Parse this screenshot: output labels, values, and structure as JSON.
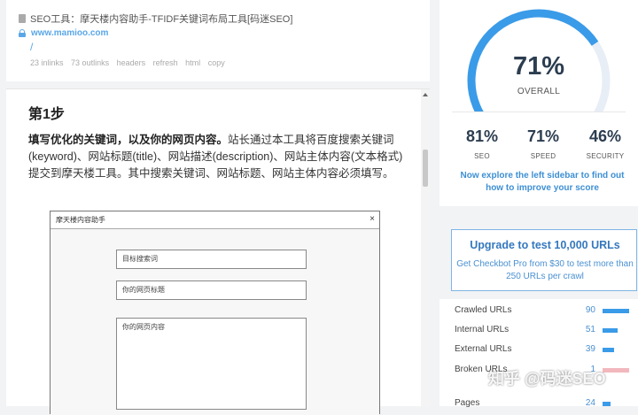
{
  "seo_card": {
    "title": "SEO工具：摩天楼内容助手-TFIDF关键词布局工具[码迷SEO]",
    "url": "www.mamioo.com",
    "path": "/",
    "links": [
      "23 inlinks",
      "73 outlinks",
      "headers",
      "refresh",
      "html",
      "copy"
    ]
  },
  "article": {
    "heading": "第1步",
    "bold_intro": "填写优化的关键词，以及你的网页内容。",
    "body": "站长通过本工具将百度搜索关键词(keyword)、网站标题(title)、网站描述(description)、网站主体内容(文本格式)提交到摩天楼工具。其中搜索关键词、网站标题、网站主体内容必须填写。",
    "app_window": {
      "title": "摩天楼内容助手",
      "close": "×",
      "keyword_placeholder": "目标搜索词",
      "title_placeholder": "你的网页标题",
      "content_placeholder": "你的网页内容"
    }
  },
  "score": {
    "overall_value": "71%",
    "overall_fraction": 0.71,
    "overall_label": "OVERALL",
    "metrics": [
      {
        "value": "81%",
        "label": "SEO"
      },
      {
        "value": "71%",
        "label": "SPEED"
      },
      {
        "value": "46%",
        "label": "SECURITY"
      }
    ],
    "hint": "Now explore the left sidebar to find out how to improve your score",
    "colors": {
      "gauge": "#3a9be8",
      "track": "#e7eef6"
    }
  },
  "upgrade": {
    "title": "Upgrade to test 10,000 URLs",
    "subtitle": "Get Checkbot Pro from $30 to test more than 250 URLs per crawl"
  },
  "url_stats": [
    {
      "label": "Crawled URLs",
      "value": "90",
      "fraction": 1.0,
      "color": "#3a9be8"
    },
    {
      "label": "Internal URLs",
      "value": "51",
      "fraction": 0.57,
      "color": "#3a9be8"
    },
    {
      "label": "External URLs",
      "value": "39",
      "fraction": 0.43,
      "color": "#3a9be8"
    },
    {
      "label": "Broken URLs",
      "value": "1",
      "fraction": 1.0,
      "color": "#f2b8bd"
    },
    {
      "label": "Pages",
      "value": "24",
      "fraction": 0.3,
      "color": "#3a9be8"
    }
  ],
  "watermark": "知乎 @码迷SEO"
}
